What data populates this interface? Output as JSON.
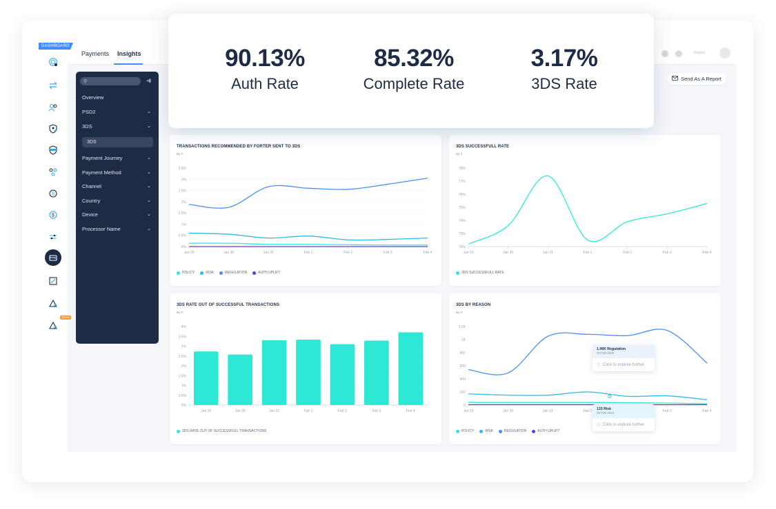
{
  "app": {
    "badge": "DASHBOARD",
    "tabs": [
      {
        "label": "Payments",
        "active": false
      },
      {
        "label": "Insights",
        "active": true
      }
    ],
    "send_report_label": "Send As A Report",
    "user_label": "Shaked"
  },
  "rail_icons": [
    "fingerprint-icon",
    "transfer-icon",
    "users-icon",
    "shield-user-icon",
    "shield-card-icon",
    "flow-icon",
    "dollar-refresh-icon",
    "dollar-cycle-icon",
    "sliders-icon",
    "card-report-icon",
    "chart-doc-icon",
    "triangle-ruler-icon",
    "triangle-ruler-soon-icon"
  ],
  "rail_soon_badge": "SOON",
  "sidebar": {
    "search_placeholder": "",
    "items": [
      {
        "label": "Overview",
        "chevron": false
      },
      {
        "label": "PSD2",
        "chevron": true
      },
      {
        "label": "3DS",
        "chevron": true
      },
      {
        "label": "Payment Journey",
        "chevron": true
      },
      {
        "label": "Payment Method",
        "chevron": true
      },
      {
        "label": "Channel",
        "chevron": true
      },
      {
        "label": "Country",
        "chevron": true
      },
      {
        "label": "Device",
        "chevron": true
      },
      {
        "label": "Processor Name",
        "chevron": true
      }
    ],
    "active_sub_item": "3DS"
  },
  "kpis": [
    {
      "value": "90.13%",
      "label": "Auth Rate"
    },
    {
      "value": "85.32%",
      "label": "Complete Rate"
    },
    {
      "value": "3.17%",
      "label": "3DS Rate"
    }
  ],
  "colors": {
    "policy": "#2ee8d6",
    "risk": "#2cbbe8",
    "regulation": "#4a8ff0",
    "auth_uplift": "#5b3de0",
    "navy": "#1e2b45",
    "accent": "#3f8cff"
  },
  "chart_data": [
    {
      "type": "line",
      "title": "TRANSACTIONS RECOMMENDED BY FORTER SENT TO 3DS",
      "subtitle": "By #",
      "categories": [
        "Jan 29",
        "Jan 30",
        "Jan 31",
        "Feb 1",
        "Feb 2",
        "Feb 3",
        "Feb 4"
      ],
      "yticks": [
        "0%",
        "0.5%",
        "1%",
        "1.5%",
        "2%",
        "2.5%",
        "3%",
        "3.5%"
      ],
      "ylim": [
        0,
        3.5
      ],
      "series": [
        {
          "name": "POLICY",
          "key": "policy",
          "values": [
            0.15,
            0.15,
            0.1,
            0.1,
            0.08,
            0.07,
            0.07
          ]
        },
        {
          "name": "RISK",
          "key": "risk",
          "values": [
            0.6,
            0.55,
            0.38,
            0.47,
            0.3,
            0.32,
            0.38
          ]
        },
        {
          "name": "REGULATION",
          "key": "regulation",
          "values": [
            1.88,
            1.75,
            2.67,
            2.6,
            2.55,
            2.78,
            3.05
          ]
        },
        {
          "name": "AUTH UPLIFT",
          "key": "auth_uplift",
          "values": [
            0,
            0,
            0,
            0,
            0,
            0,
            0
          ]
        }
      ]
    },
    {
      "type": "line",
      "title": "3DS SUCCESSFULL RATE",
      "subtitle": "By #",
      "categories": [
        "Jan 29",
        "Jan 30",
        "Jan 31",
        "Feb 1",
        "Feb 2",
        "Feb 3",
        "Feb 4"
      ],
      "yticks": [
        "72%",
        "73%",
        "74%",
        "75%",
        "76%",
        "77%",
        "78%"
      ],
      "ylim": [
        72,
        78
      ],
      "series": [
        {
          "name": "3DS SUCCESSFULL RATE",
          "key": "policy",
          "values": [
            72.2,
            73.6,
            77.4,
            72.5,
            73.9,
            74.5,
            75.3
          ]
        }
      ]
    },
    {
      "type": "bar",
      "title": "3DS RATE OUT OF SUCCESSFUL TRANSACTIONS",
      "subtitle": "By #",
      "categories": [
        "Jan 29",
        "Jan 30",
        "Jan 31",
        "Feb 1",
        "Feb 2",
        "Feb 3",
        "Feb 4"
      ],
      "yticks": [
        "0%",
        "0.5%",
        "1%",
        "1.5%",
        "2%",
        "2.5%",
        "3%",
        "3.5%",
        "4%"
      ],
      "ylim": [
        0,
        4
      ],
      "series": [
        {
          "name": "3DS RATE OUT OF SUCCESSFULL TRANSACTIONS",
          "key": "policy",
          "values": [
            2.73,
            2.57,
            3.3,
            3.33,
            3.1,
            3.28,
            3.7
          ]
        }
      ]
    },
    {
      "type": "line",
      "title": "3DS BY REASON",
      "subtitle": "By #",
      "categories": [
        "Jan 29",
        "Jan 30",
        "Jan 31",
        "Feb 1",
        "Feb 2",
        "Feb 3",
        "Feb 4"
      ],
      "yticks": [
        "0",
        "200",
        "400",
        "600",
        "800",
        "1K",
        "1.2K"
      ],
      "ylim": [
        0,
        1200
      ],
      "series": [
        {
          "name": "POLICY",
          "key": "policy",
          "values": [
            40,
            40,
            40,
            40,
            35,
            30,
            20
          ]
        },
        {
          "name": "RISK",
          "key": "risk",
          "values": [
            170,
            150,
            150,
            200,
            133,
            140,
            80
          ]
        },
        {
          "name": "REGULATION",
          "key": "regulation",
          "values": [
            540,
            490,
            1050,
            1080,
            1060,
            1140,
            640
          ]
        },
        {
          "name": "AUTH UPLIFT",
          "key": "auth_uplift",
          "values": [
            5,
            5,
            5,
            5,
            5,
            5,
            5
          ]
        }
      ],
      "tooltips": [
        {
          "title": "1.06K Regulation",
          "date": "02 Feb 2022",
          "action": "Click to explore further"
        },
        {
          "title": "133 Risk",
          "date": "02 Feb 2022",
          "action": "Click to explore further"
        }
      ]
    }
  ]
}
